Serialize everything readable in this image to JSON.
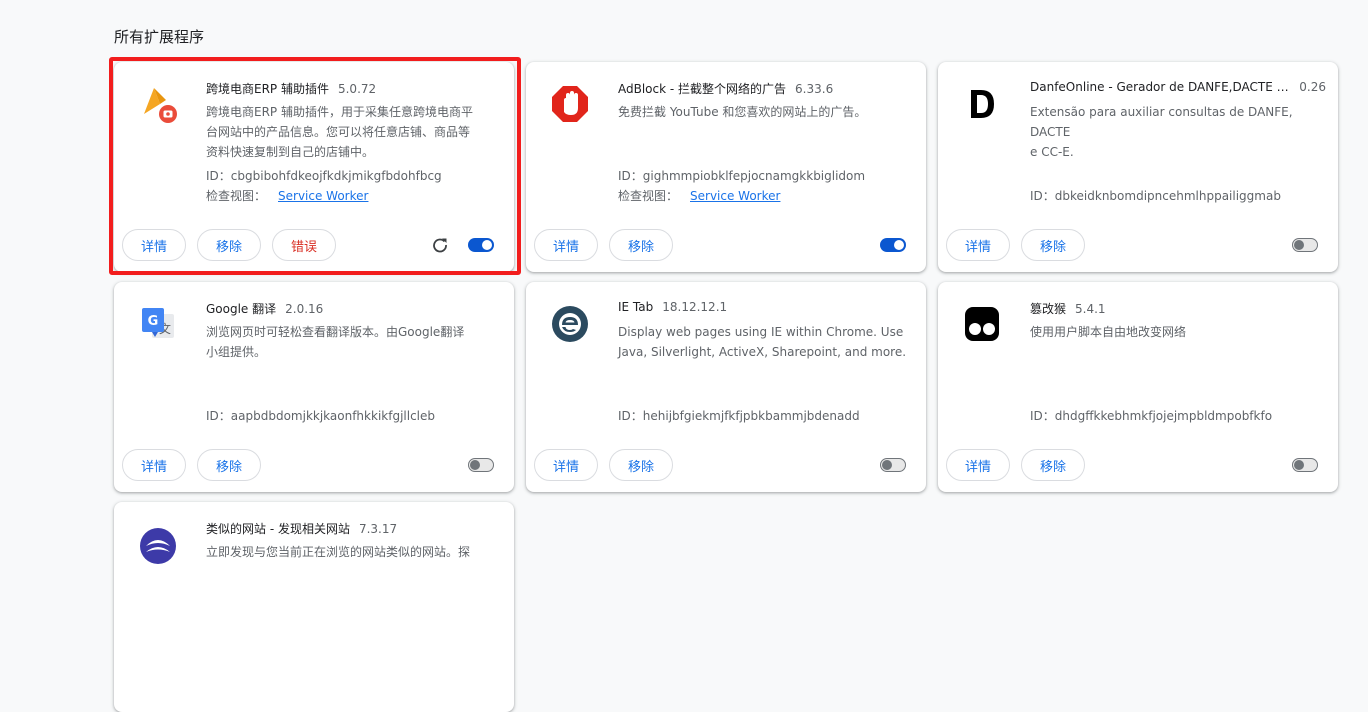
{
  "section_title": "所有扩展程序",
  "common": {
    "details_label": "详情",
    "remove_label": "移除",
    "errors_label": "错误",
    "inspect_label": "检查视图：",
    "service_worker_label": "Service Worker"
  },
  "extensions": [
    {
      "name": "跨境电商ERP 辅助插件",
      "version": "5.0.72",
      "description": [
        "跨境电商ERP 辅助插件，用于采集任意跨境电商平",
        "台网站中的产品信息。您可以将任意店铺、商品等",
        "资料快速复制到自己的店铺中。"
      ],
      "id": "ID：cbgbibohfdkeojfkdkjmikgfbdohfbcg",
      "enabled": true,
      "icon": "erp-plugin-icon"
    },
    {
      "name": "AdBlock - 拦截整个网络的广告",
      "version": "6.33.6",
      "description": [
        "免费拦截 YouTube 和您喜欢的网站上的广告。"
      ],
      "id": "ID：gighmmpiobklfepjocnamgkkbiglidom",
      "enabled": true,
      "icon": "adblock-hand-icon"
    },
    {
      "name": "DanfeOnline - Gerador de DANFE,DACTE e...",
      "version": "0.26",
      "description": [
        "Extensão para auxiliar consultas de DANFE, DACTE",
        "e CC-E."
      ],
      "id": "ID：dbkeidknbomdipncehmlhppailiggmab",
      "enabled": false,
      "icon": "danfe-d-icon"
    },
    {
      "name": "Google 翻译",
      "version": "2.0.16",
      "description": [
        "浏览网页时可轻松查看翻译版本。由Google翻译",
        "小组提供。"
      ],
      "id": "ID：aapbdbdomjkkjkaonfhkkikfgjllcleb",
      "enabled": false,
      "icon": "google-translate-icon"
    },
    {
      "name": "IE Tab",
      "version": "18.12.12.1",
      "description": [
        "Display web pages using IE within Chrome. Use",
        "Java, Silverlight, ActiveX, Sharepoint, and more."
      ],
      "id": "ID：hehijbfgiekmjfkfjpbkbammjbdenadd",
      "enabled": false,
      "icon": "ie-tab-icon"
    },
    {
      "name": "篡改猴",
      "version": "5.4.1",
      "description": [
        "使用用户脚本自由地改变网络"
      ],
      "id": "ID：dhdgffkkebhmkfjojejmpbldmpobfkfo",
      "enabled": false,
      "icon": "tampermonkey-icon"
    },
    {
      "name": "类似的网站 - 发现相关网站",
      "version": "7.3.17",
      "description": [
        "立即发现与您当前正在浏览的网站类似的网站。探"
      ],
      "id": "",
      "enabled": false,
      "icon": "similar-sites-icon"
    }
  ],
  "colors": {
    "accent": "#1a73e8",
    "toggle_on": "#0b57d0",
    "error": "#d93025",
    "highlight_box": "#f21d1d"
  }
}
